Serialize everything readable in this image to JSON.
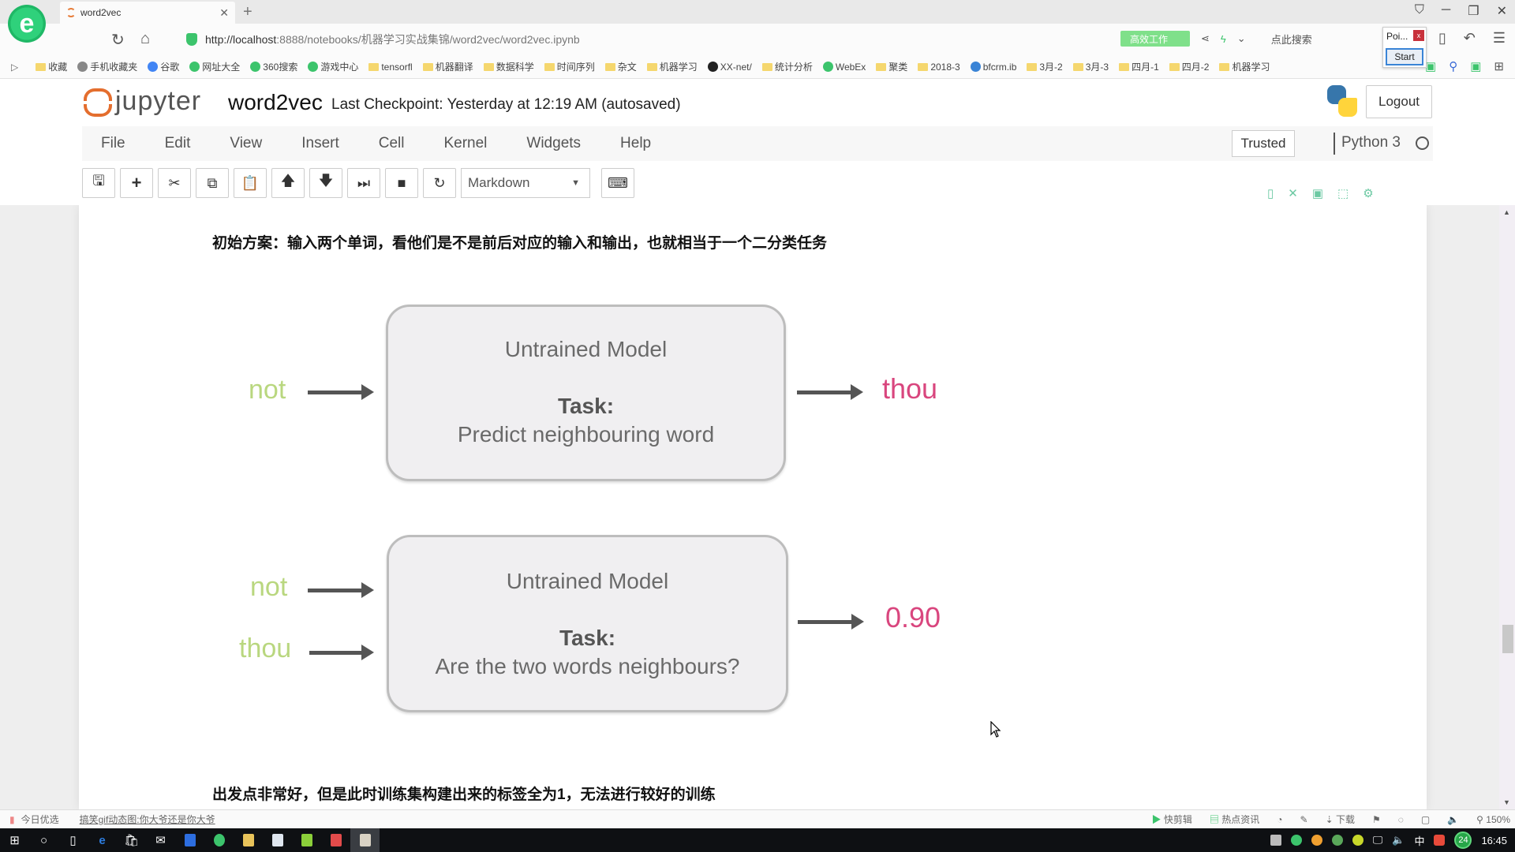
{
  "browser": {
    "tab_title": "word2vec",
    "new_tab": "+",
    "url_host": "http://localhost",
    "url_rest": ":8888/notebooks/机器学习实战集锦/word2vec/word2vec.ipynb",
    "search_placeholder": "点此搜索",
    "green_pill": "高效工作",
    "popup_label": "Poi...",
    "popup_close": "x",
    "popup_start": "Start",
    "bookmarks": [
      {
        "label": "收藏",
        "type": "folder"
      },
      {
        "label": "手机收藏夹",
        "type": "page"
      },
      {
        "label": "谷歌",
        "type": "g"
      },
      {
        "label": "网址大全",
        "type": "circle"
      },
      {
        "label": "360搜索",
        "type": "circle"
      },
      {
        "label": "游戏中心",
        "type": "circle"
      },
      {
        "label": "tensorfl",
        "type": "folder"
      },
      {
        "label": "机器翻译",
        "type": "folder"
      },
      {
        "label": "数据科学",
        "type": "folder"
      },
      {
        "label": "时间序列",
        "type": "folder"
      },
      {
        "label": "杂文",
        "type": "folder"
      },
      {
        "label": "机器学习",
        "type": "folder"
      },
      {
        "label": "XX-net/",
        "type": "github"
      },
      {
        "label": "统计分析",
        "type": "folder"
      },
      {
        "label": "WebEx",
        "type": "circle"
      },
      {
        "label": "聚类",
        "type": "folder"
      },
      {
        "label": "2018-3",
        "type": "folder"
      },
      {
        "label": "bfcrm.ib",
        "type": "link"
      },
      {
        "label": "3月-2",
        "type": "folder"
      },
      {
        "label": "3月-3",
        "type": "folder"
      },
      {
        "label": "四月-1",
        "type": "folder"
      },
      {
        "label": "四月-2",
        "type": "folder"
      },
      {
        "label": "机器学习",
        "type": "folder"
      }
    ]
  },
  "jupyter": {
    "logo_text": "jupyter",
    "notebook_name": "word2vec",
    "checkpoint": "Last Checkpoint: Yesterday at 12:19 AM (autosaved)",
    "logout": "Logout",
    "menu": [
      "File",
      "Edit",
      "View",
      "Insert",
      "Cell",
      "Kernel",
      "Widgets",
      "Help"
    ],
    "trusted": "Trusted",
    "kernel": "Python 3",
    "cell_type": "Markdown"
  },
  "notebook": {
    "intro_text": "初始方案：输入两个单词，看他们是不是前后对应的输入和输出，也就相当于一个二分类任务",
    "outro_text": "出发点非常好，但是此时训练集构建出来的标签全为1，无法进行较好的训练",
    "diagram1": {
      "input": "not",
      "model_title": "Untrained Model",
      "task_label": "Task:",
      "task_desc": "Predict neighbouring word",
      "output": "thou"
    },
    "diagram2": {
      "input1": "not",
      "input2": "thou",
      "model_title": "Untrained Model",
      "task_label": "Task:",
      "task_desc": "Are the two words neighbours?",
      "output": "0.90"
    }
  },
  "statusbar": {
    "today": "今日优选",
    "news": "搞笑gif动态图:你大爷还是你大爷",
    "right_items": [
      "快剪辑",
      "热点资讯",
      "下载"
    ],
    "zoom": "150%"
  },
  "taskbar": {
    "ime": "中",
    "badge": "24",
    "clock": "16:45"
  },
  "colors": {
    "input_word": "#b9d77f",
    "output_word": "#d9467e",
    "jupyter_orange": "#e46e2e"
  }
}
